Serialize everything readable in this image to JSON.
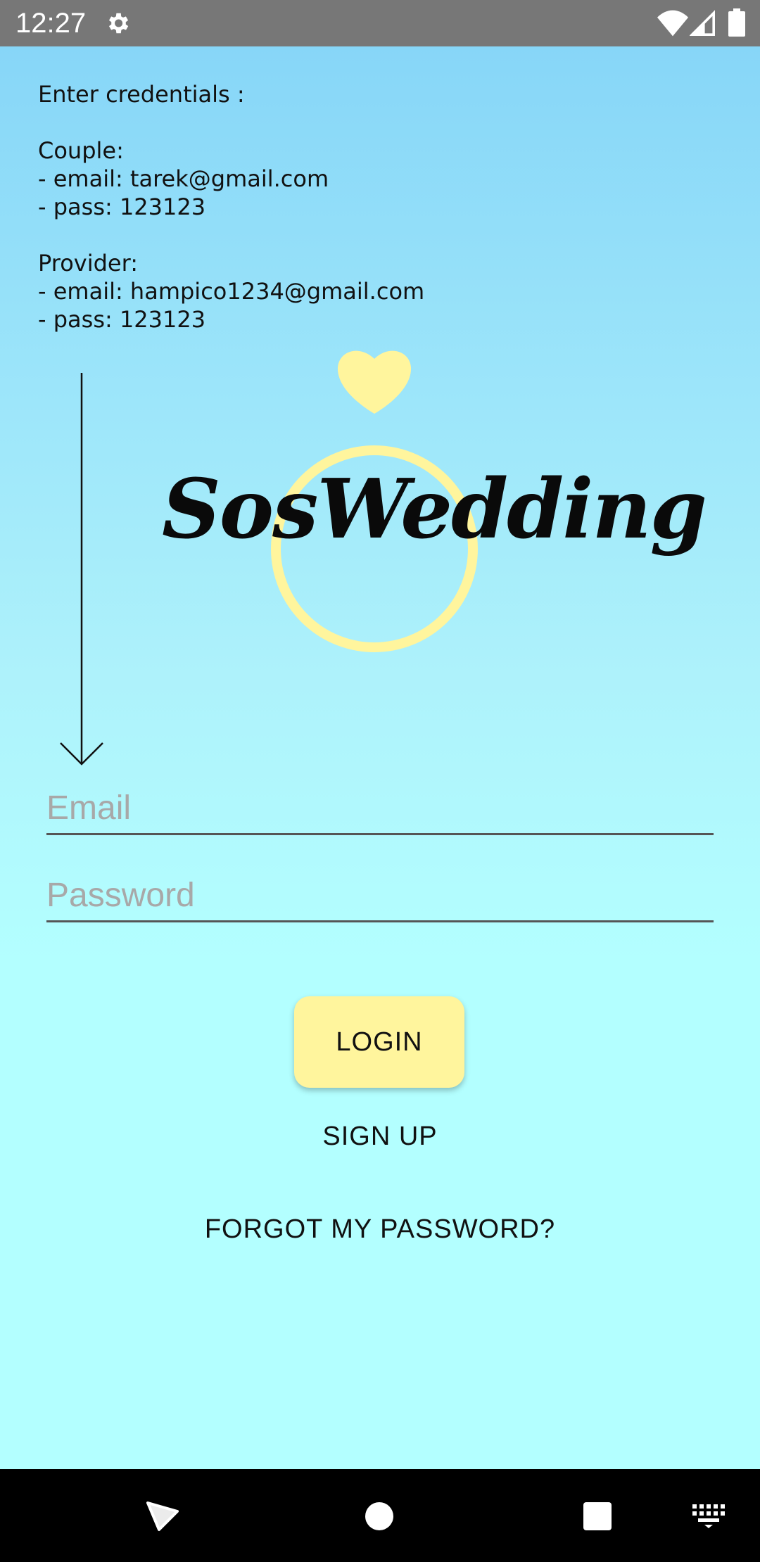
{
  "status_bar": {
    "time": "12:27",
    "icons": [
      "gear-icon",
      "wifi-icon",
      "signal-icon",
      "battery-icon"
    ]
  },
  "credentials": {
    "heading": "Enter credentials :",
    "couple_label": "Couple:",
    "couple_email": "- email: tarek@gmail.com",
    "couple_pass": "- pass: 123123",
    "provider_label": "Provider:",
    "provider_email": "- email: hampico1234@gmail.com",
    "provider_pass": "- pass: 123123"
  },
  "logo": {
    "text": "SosWedding",
    "ring_color": "#fff59d",
    "heart_color": "#fff59d"
  },
  "form": {
    "email_placeholder": "Email",
    "password_placeholder": "Password",
    "login_label": "LOGIN",
    "signup_label": "SIGN UP",
    "forgot_label": "FORGOT MY PASSWORD?"
  },
  "colors": {
    "status_bar": "#777777",
    "background_top": "#87d6f8",
    "background_bottom": "#b3ffff",
    "login_button": "#fff59d",
    "nav_bar": "#000000"
  },
  "nav_bar": {
    "icons": [
      "back-icon",
      "home-icon",
      "recents-icon",
      "keyboard-icon"
    ]
  }
}
